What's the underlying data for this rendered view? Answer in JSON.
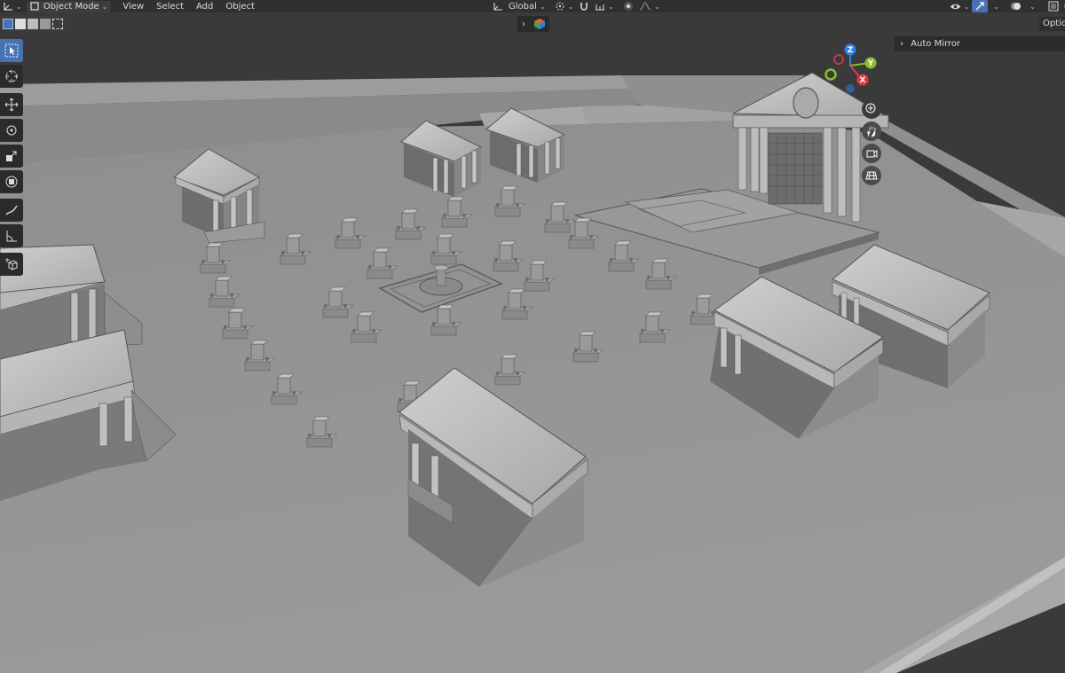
{
  "header": {
    "mode_label": "Object Mode",
    "menus": [
      "View",
      "Select",
      "Add",
      "Object"
    ],
    "transform_orientation": "Global"
  },
  "options_label": "Optio",
  "auto_mirror_label": "Auto Mirror",
  "gizmo": {
    "x_label": "X",
    "y_label": "Y",
    "z_label": "Z"
  },
  "colors": {
    "x_axis": "#e0384b",
    "y_axis": "#8bbd2e",
    "z_axis": "#2f83e3",
    "active_tool": "#4772b3",
    "viewport_bg": "#3a3a3a",
    "ground": "#8c8c8c"
  },
  "tools": [
    "select-box-icon",
    "cursor-icon",
    "move-icon",
    "rotate-icon",
    "scale-icon",
    "transform-icon",
    "annotate-icon",
    "measure-icon",
    "add-cube-icon"
  ]
}
